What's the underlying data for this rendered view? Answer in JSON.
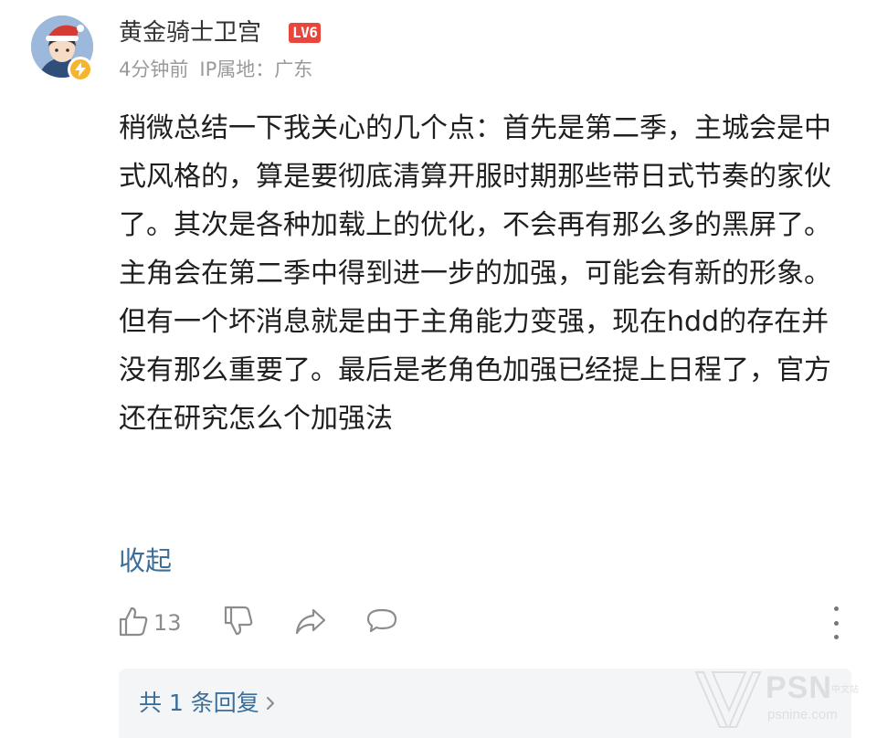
{
  "comment": {
    "username": "黄金骑士卫宫",
    "level": "LV6",
    "time": "4分钟前",
    "ip_location": "IP属地：广东",
    "text": "稍微总结一下我关心的几个点：首先是第二季，主城会是中式风格的，算是要彻底清算开服时期那些带日式节奏的家伙了。其次是各种加载上的优化，不会再有那么多的黑屏了。主角会在第二季中得到进一步的加强，可能会有新的形象。但有一个坏消息就是由于主角能力变强，现在hdd的存在并没有那么重要了。最后是老角色加强已经提上日程了，官方还在研究怎么个加强法",
    "collapse_label": "收起",
    "like_count": "13",
    "replies_label": "共 1 条回复"
  },
  "icons": {
    "like": "thumbs-up-icon",
    "dislike": "thumbs-down-icon",
    "share": "share-icon",
    "reply": "comment-bubble-icon",
    "more": "more-vertical-icon",
    "badge": "lightning-badge-icon"
  },
  "watermark": {
    "brand": "PSN",
    "tag": "中文站",
    "url": "psnine.com"
  },
  "colors": {
    "link": "#3b6e9b",
    "level_badge": "#e8453c",
    "muted": "#9a9a9a",
    "reply_bg": "#f4f5f7",
    "verified": "#f7b52c"
  }
}
